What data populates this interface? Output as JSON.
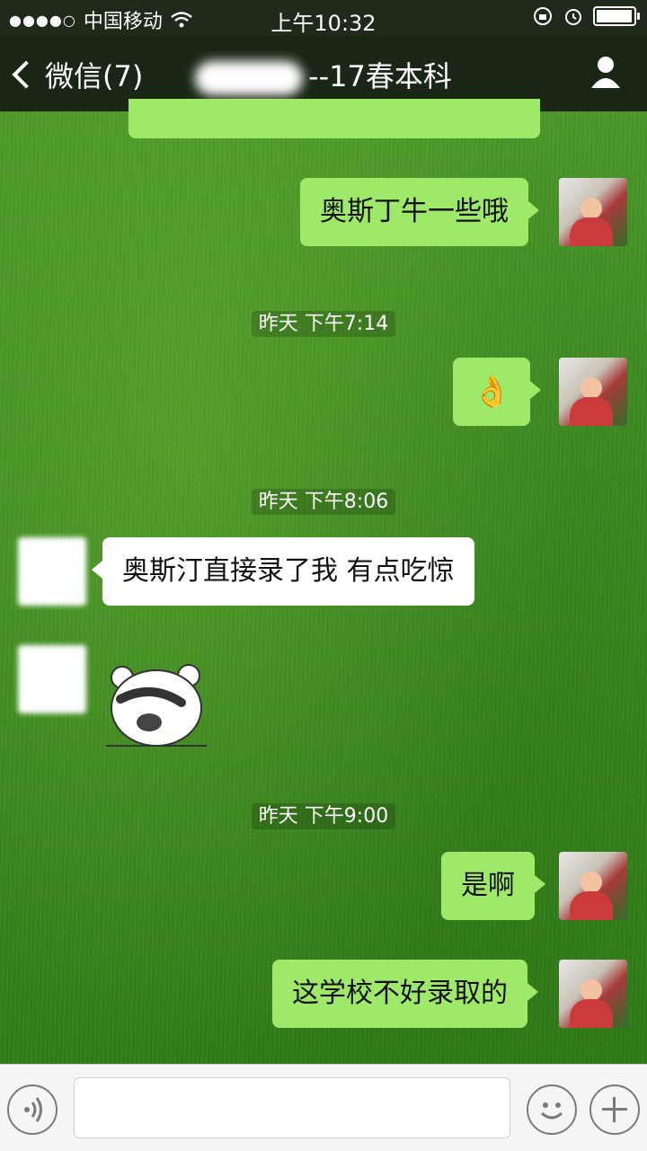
{
  "status_bar": {
    "signal": "●●●●○",
    "carrier": "中国移动",
    "time": "上午10:32"
  },
  "nav": {
    "back_label": "微信(7)",
    "title": "--17春本科"
  },
  "timestamps": [
    "昨天 下午7:14",
    "昨天 下午8:06",
    "昨天 下午9:00"
  ],
  "messages": {
    "m1": "奥斯丁牛一些哦",
    "m2": "👌",
    "m3": "奥斯汀直接录了我 有点吃惊",
    "m4": "是啊",
    "m5": "这学校不好录取的"
  },
  "colors": {
    "my_bubble": "#9ee86a",
    "other_bubble": "#ffffff",
    "nav_bg": "#161e14"
  },
  "icons": {
    "back": "chevron-left-icon",
    "profile": "person-icon",
    "voice": "voice-icon",
    "emoji": "emoji-icon",
    "plus": "plus-icon"
  }
}
